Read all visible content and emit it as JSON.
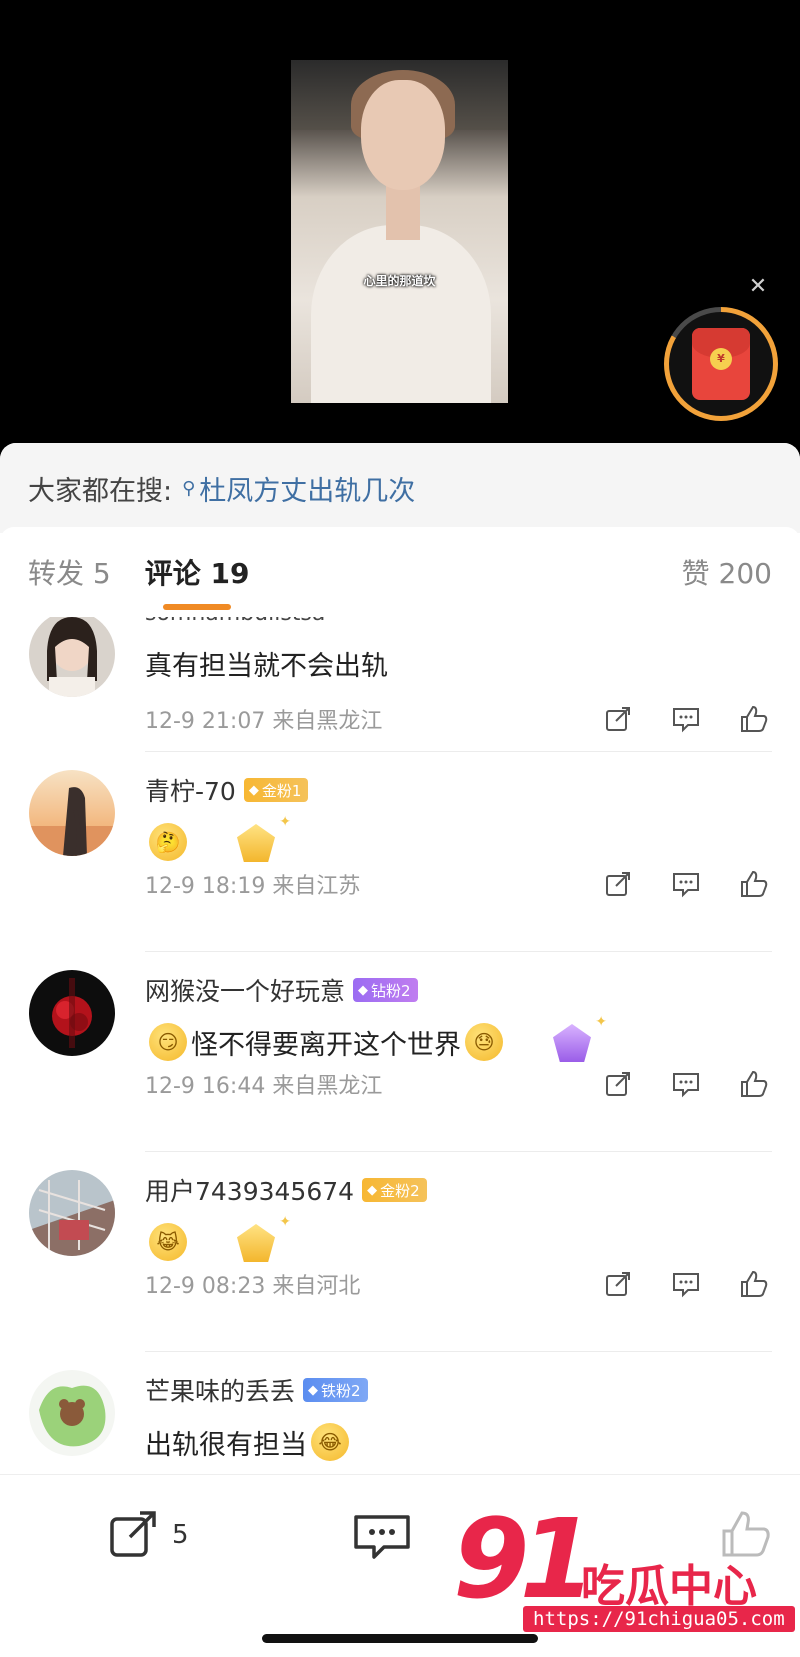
{
  "video": {
    "caption": "心里的那道坎",
    "close_icon": "close-icon",
    "redpacket_coin": "¥",
    "accent": "#f2a23a"
  },
  "hot_search": {
    "label": "大家都在搜:",
    "query": "杜凤方丈出轨几次",
    "icon": "search-icon"
  },
  "tabs": {
    "repost": "转发 5",
    "comments": "评论 19",
    "likes": "赞 200",
    "accent": "#f08a24"
  },
  "comments": [
    {
      "user": "somnambulistsa",
      "badge": "",
      "text": "真有担当就不会出轨",
      "meta": "12-9 21:07  来自黑龙江"
    },
    {
      "user": "青柠-70",
      "badge": "金粉1",
      "text": "",
      "meta": "12-9 18:19  来自江苏"
    },
    {
      "user": "网猴没一个好玩意",
      "badge": "钻粉2",
      "text": "怪不得要离开这个世界",
      "meta": "12-9 16:44  来自黑龙江"
    },
    {
      "user": "用户7439345674",
      "badge": "金粉2",
      "text": "",
      "meta": "12-9 08:23  来自河北"
    },
    {
      "user": "芒果味的丢丢",
      "badge": "铁粉2",
      "text": "出轨很有担当",
      "meta": ""
    }
  ],
  "bottom_bar": {
    "repost_count": "5"
  },
  "watermark": {
    "number": "91",
    "name": "吃瓜中心",
    "url": "https://91chigua05.com"
  }
}
